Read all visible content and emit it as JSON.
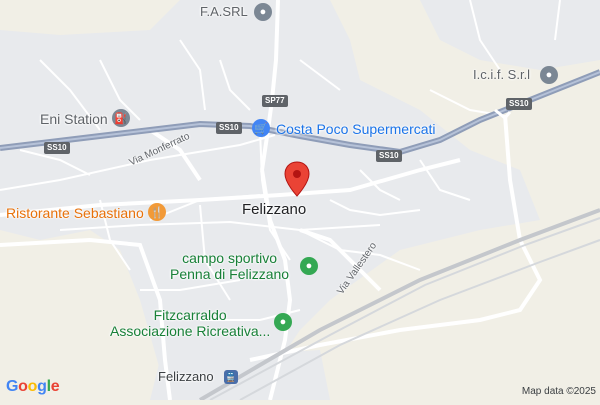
{
  "map": {
    "places": {
      "town": "Felizzano",
      "station": "Felizzano"
    },
    "pois": [
      {
        "id": "fasrl",
        "label": "F.A.SRL",
        "icon": "location-pin-icon"
      },
      {
        "id": "icif",
        "label": "I.c.i.f. S.r.l",
        "icon": "location-pin-icon"
      },
      {
        "id": "eni",
        "label": "Eni Station",
        "icon": "gas-station-icon"
      },
      {
        "id": "costa",
        "label": "Costa Poco Supermercati",
        "icon": "shopping-cart-icon"
      },
      {
        "id": "ristorante",
        "label": "Ristorante Sebastiano",
        "icon": "restaurant-icon"
      },
      {
        "id": "campo",
        "label": "campo sportivo\nPenna di Felizzano",
        "icon": "sports-pin-icon"
      },
      {
        "id": "fitz",
        "label": "Fitzcarraldo\nAssociazione Ricreativa...",
        "icon": "sports-pin-icon"
      }
    ],
    "streets": {
      "monferrato": "Via Monferrato",
      "vallestero": "Via Vallestero"
    },
    "shields": {
      "ss10_a": "SS10",
      "ss10_b": "SS10",
      "ss10_c": "SS10",
      "ss10_d": "SS10",
      "sp77": "SP77"
    },
    "brand": [
      "G",
      "o",
      "o",
      "g",
      "l",
      "e"
    ],
    "brand_colors": [
      "#4285F4",
      "#EA4335",
      "#FBBC05",
      "#4285F4",
      "#34A853",
      "#EA4335"
    ],
    "attribution": "Map data ©2025",
    "colors": {
      "marker": "#ea4335",
      "water_land": "#f1efe6",
      "urban": "#e8eaed",
      "road": "#ffffff",
      "highway": "#8f9db8"
    }
  }
}
